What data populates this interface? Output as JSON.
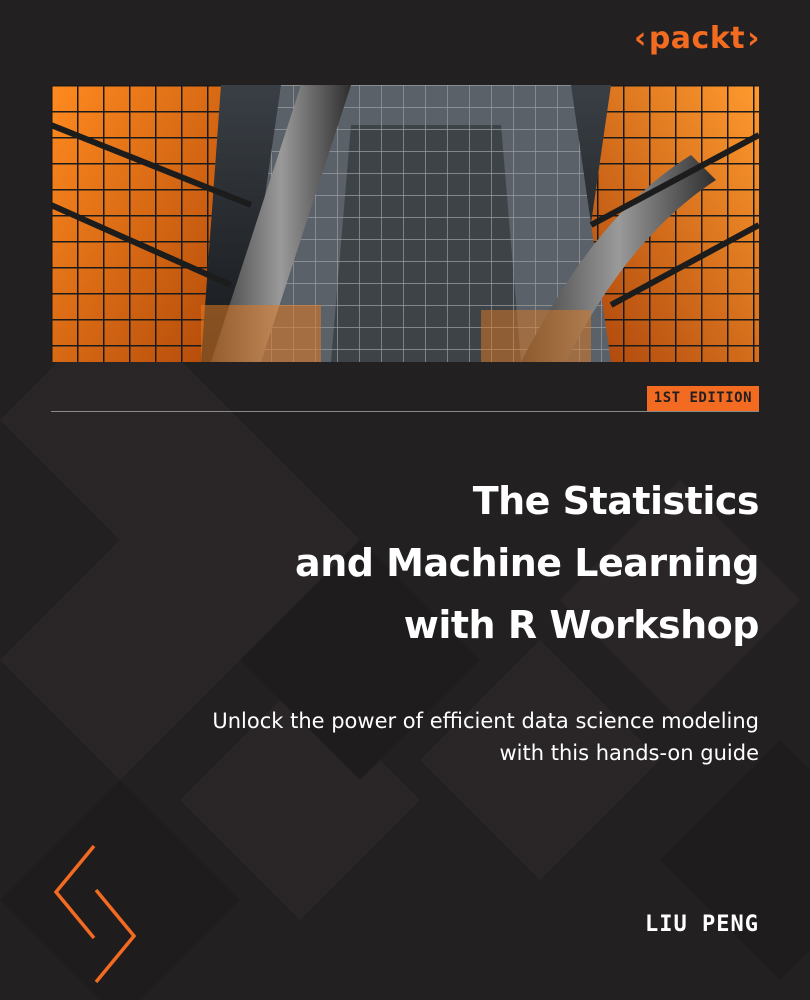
{
  "publisher": {
    "logo_left": "‹",
    "logo_word": "packt",
    "logo_right": "›",
    "accent_color": "#f26b21"
  },
  "cover_image": {
    "icon": "atrium-photo-icon"
  },
  "edition": "1ST EDITION",
  "title_lines": [
    "The Statistics",
    "and Machine Learning",
    "with R Workshop"
  ],
  "subtitle_lines": [
    "Unlock the power of efficient data science modeling",
    "with this hands-on guide"
  ],
  "author": "LIU PENG",
  "colors": {
    "background": "#232021",
    "text": "#ffffff",
    "rule": "#8a8a8a"
  },
  "decoration": {
    "icon": "chevron-icon"
  }
}
